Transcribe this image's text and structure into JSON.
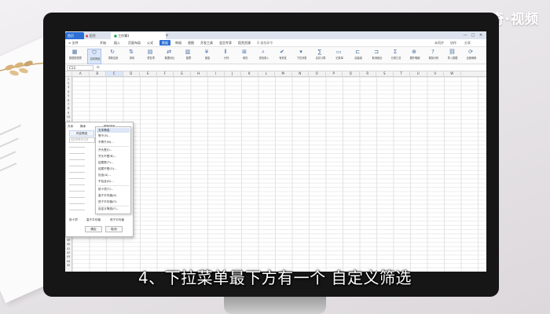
{
  "watermark": "天奇·视频",
  "caption": "4、下拉菜单最下方有一个 自定义筛选",
  "tabs": {
    "home": "首页",
    "wps": "稻壳",
    "workbook": "工作簿1",
    "add": "+"
  },
  "window_controls": [
    "—",
    "□",
    "✕"
  ],
  "menu": {
    "file": "≡ 文件",
    "items": [
      "开始",
      "插入",
      "页面布局",
      "公式",
      "数据",
      "审阅",
      "视图",
      "开发工具",
      "会员专享",
      "稻壳资源"
    ],
    "active": "数据",
    "search": "Q 查找命令",
    "right": [
      "未同步",
      "协作",
      "分享"
    ]
  },
  "ribbon": [
    {
      "icon": "pivot-table-icon",
      "glyph": "▦",
      "label": "数据透视表"
    },
    {
      "icon": "filter-icon",
      "glyph": "⛉",
      "label": "自动筛选"
    },
    {
      "icon": "reapply-icon",
      "glyph": "↻",
      "label": "重新应用"
    },
    {
      "icon": "sort-icon",
      "glyph": "⇅",
      "label": "排序"
    },
    {
      "icon": "highlight-duplicates-icon",
      "glyph": "▤",
      "label": "重复项"
    },
    {
      "icon": "data-compare-icon",
      "glyph": "⇄",
      "label": "数据对比"
    },
    {
      "icon": "stock-icon",
      "glyph": "▥",
      "label": "股票"
    },
    {
      "icon": "fund-icon",
      "glyph": "¥",
      "label": "基金"
    },
    {
      "icon": "split-icon",
      "glyph": "⫴",
      "label": "分列"
    },
    {
      "icon": "fill-icon",
      "glyph": "⊞",
      "label": "填充"
    },
    {
      "icon": "find-entry-icon",
      "glyph": "⌕",
      "label": "查找录入"
    },
    {
      "icon": "validity-icon",
      "glyph": "✔",
      "label": "有效性"
    },
    {
      "icon": "dropdown-list-icon",
      "glyph": "▾",
      "label": "下拉列表"
    },
    {
      "icon": "merge-calc-icon",
      "glyph": "∑",
      "label": "合并计算"
    },
    {
      "icon": "record-sheet-icon",
      "glyph": "▭",
      "label": "记录单"
    },
    {
      "icon": "create-group-icon",
      "glyph": "⊏",
      "label": "创建组"
    },
    {
      "icon": "ungroup-icon",
      "glyph": "⊐",
      "label": "取消组合"
    },
    {
      "icon": "subtotal-icon",
      "glyph": "Σ",
      "label": "分类汇总"
    },
    {
      "icon": "expand-detail-icon",
      "glyph": "⊕",
      "label": "展开明细"
    },
    {
      "icon": "simulation-icon",
      "glyph": "?",
      "label": "模拟分析"
    },
    {
      "icon": "web-link-icon",
      "glyph": "⛓",
      "label": "导入数据"
    },
    {
      "icon": "refresh-all-icon",
      "glyph": "⟳",
      "label": "全部刷新"
    }
  ],
  "formula_bar": {
    "name_box": "C13",
    "fx": "fx"
  },
  "columns": [
    "A",
    "B",
    "C",
    "D",
    "E",
    "F",
    "G",
    "H",
    "I",
    "J",
    "K",
    "L",
    "M",
    "N",
    "O",
    "P",
    "Q",
    "R",
    "S",
    "T",
    "U",
    "V",
    "W"
  ],
  "rows_visible": [
    "1",
    "2",
    "3",
    "4",
    "5",
    "6",
    "7",
    "8",
    "9",
    "10",
    "11",
    "12",
    "13",
    "14",
    "15",
    "16",
    "17",
    "18",
    "19",
    "20",
    "21",
    "22",
    "23",
    "24",
    "25",
    "26",
    "27",
    "28",
    "29",
    "30",
    "31",
    "32",
    "33",
    "34",
    "35",
    "36",
    "37",
    "38",
    "39",
    "40",
    "41",
    "42",
    "43",
    "44",
    "45"
  ],
  "filter_panel": {
    "tabs": [
      "升序",
      "降序",
      "颜色排序"
    ],
    "section": "内容筛选",
    "search_placeholder": "支持多条件过滤",
    "bottom_left": "前十项",
    "bottom_mid": "高于平均值",
    "bottom_right": "低于平均值",
    "ok": "确定",
    "cancel": "取消"
  },
  "text_filter_menu": {
    "header": "文本筛选",
    "items": [
      "等于(E)...",
      "不等于(N)...",
      "开头是(I)...",
      "开头不是(B)...",
      "结尾是(T)...",
      "结尾不是(O)...",
      "包含(A)...",
      "不包含(D)...",
      "前十项(T)...",
      "高于平均值(A)",
      "低于平均值(O)",
      "自定义筛选(F)..."
    ]
  }
}
